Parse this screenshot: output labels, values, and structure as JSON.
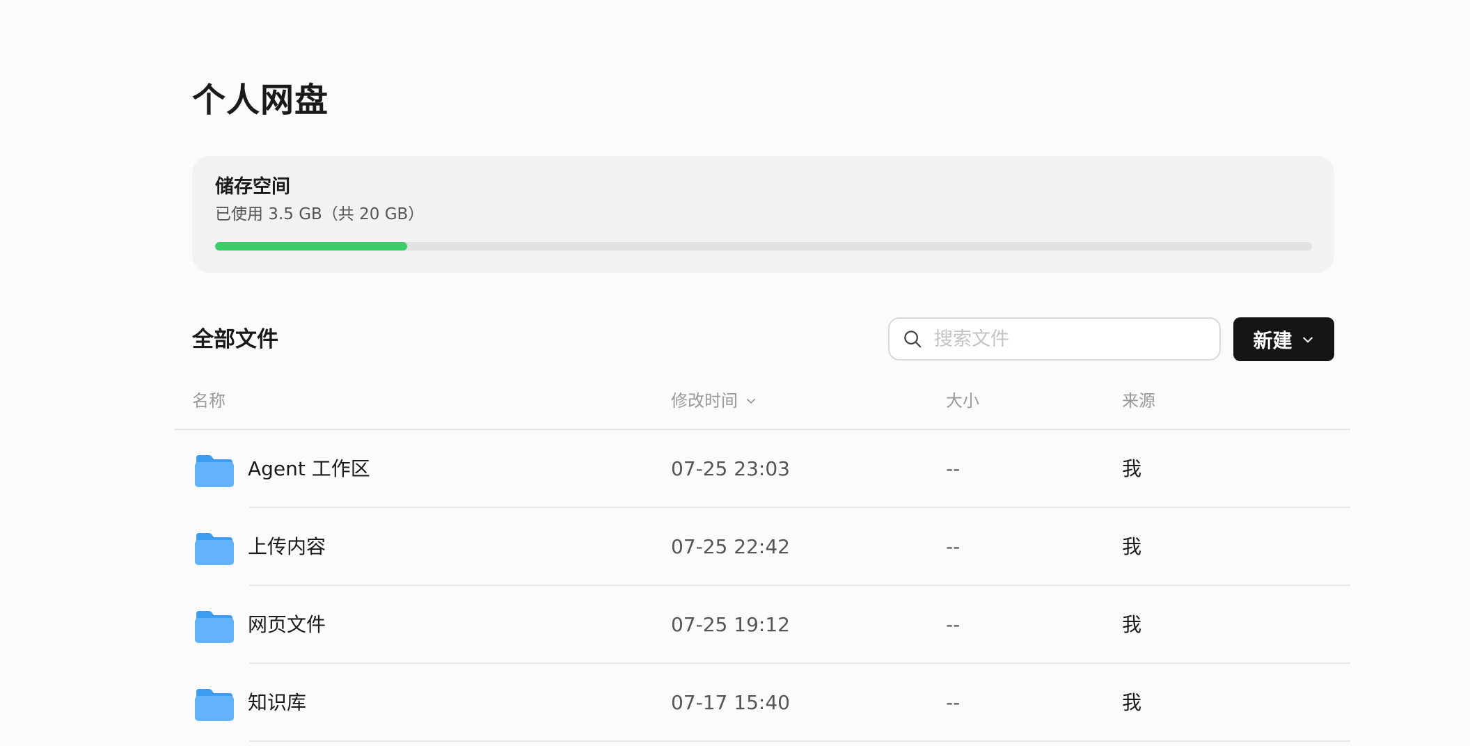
{
  "page": {
    "title": "个人网盘"
  },
  "storage": {
    "title": "储存空间",
    "usage_text": "已使用 3.5 GB（共 20 GB）",
    "used_fraction": 0.175,
    "fill_color": "#3ccd6a"
  },
  "files": {
    "section_title": "全部文件",
    "search": {
      "placeholder": "搜索文件",
      "value": ""
    },
    "new_button_label": "新建",
    "columns": {
      "name": "名称",
      "modified": "修改时间",
      "size": "大小",
      "source": "来源"
    },
    "rows": [
      {
        "name": "Agent 工作区",
        "modified": "07-25 23:03",
        "size": "--",
        "source": "我"
      },
      {
        "name": "上传内容",
        "modified": "07-25 22:42",
        "size": "--",
        "source": "我"
      },
      {
        "name": "网页文件",
        "modified": "07-25 19:12",
        "size": "--",
        "source": "我"
      },
      {
        "name": "知识库",
        "modified": "07-17 15:40",
        "size": "--",
        "source": "我"
      }
    ]
  },
  "icons": {
    "search": "search-icon",
    "new_dropdown": "chevron-down-icon",
    "sort": "chevron-down-icon",
    "folder": "folder-icon"
  }
}
